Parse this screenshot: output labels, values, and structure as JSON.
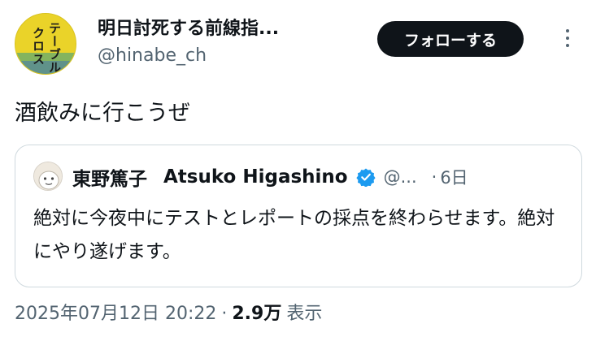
{
  "author": {
    "display_name": "明日討死する前線指...",
    "handle": "@hinabe_ch",
    "avatar_text": [
      "テーブル",
      "クロス"
    ]
  },
  "actions": {
    "follow_label": "フォローする"
  },
  "tweet": {
    "text": "酒飲みに行こうぜ"
  },
  "quote": {
    "name_jp": "東野篤子",
    "name_en": "Atsuko Higashino",
    "handle": "@...",
    "separator": "·",
    "time": "6日",
    "text": "絶対に今夜中にテストとレポートの採点を終わらせます。絶対にやり遂げます。"
  },
  "meta": {
    "timestamp": "2025年07月12日 20:22",
    "separator": "·",
    "views": "2.9万",
    "views_label": "表示"
  },
  "colors": {
    "text": "#0f1419",
    "secondary": "#536471",
    "verified": "#1d9bf0",
    "border": "#cfd9de"
  }
}
